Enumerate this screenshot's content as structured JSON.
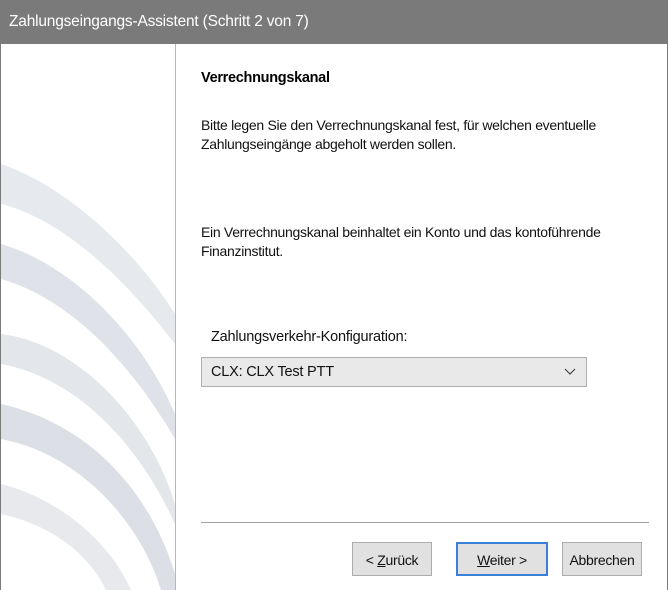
{
  "window": {
    "title": "Zahlungseingangs-Assistent (Schritt 2 von 7)"
  },
  "page": {
    "heading": "Verrechnungskanal",
    "paragraph1": "Bitte legen Sie den Verrechnungskanal fest, für welchen eventuelle Zahlungseingänge abgeholt werden sollen.",
    "paragraph2": "Ein Verrechnungskanal beinhaltet ein Konto und das kontoführende Finanzinstitut."
  },
  "config": {
    "label": "Zahlungsverkehr-Konfiguration:",
    "selected": "CLX: CLX Test PTT"
  },
  "buttons": {
    "back_prefix": "< ",
    "back_mnemonic": "Z",
    "back_rest": "urück",
    "next_mnemonic": "W",
    "next_rest": "eiter >",
    "cancel": "Abbrechen"
  },
  "colors": {
    "titlebar": "#7a7a7a",
    "button_face": "#e1e1e1",
    "default_button_border": "#3c7fd6",
    "sidebar_swoosh": "#dde1e8"
  },
  "icons": {
    "dropdown": "chevron-down-icon",
    "sidebar_art": "swoosh-decoration"
  }
}
